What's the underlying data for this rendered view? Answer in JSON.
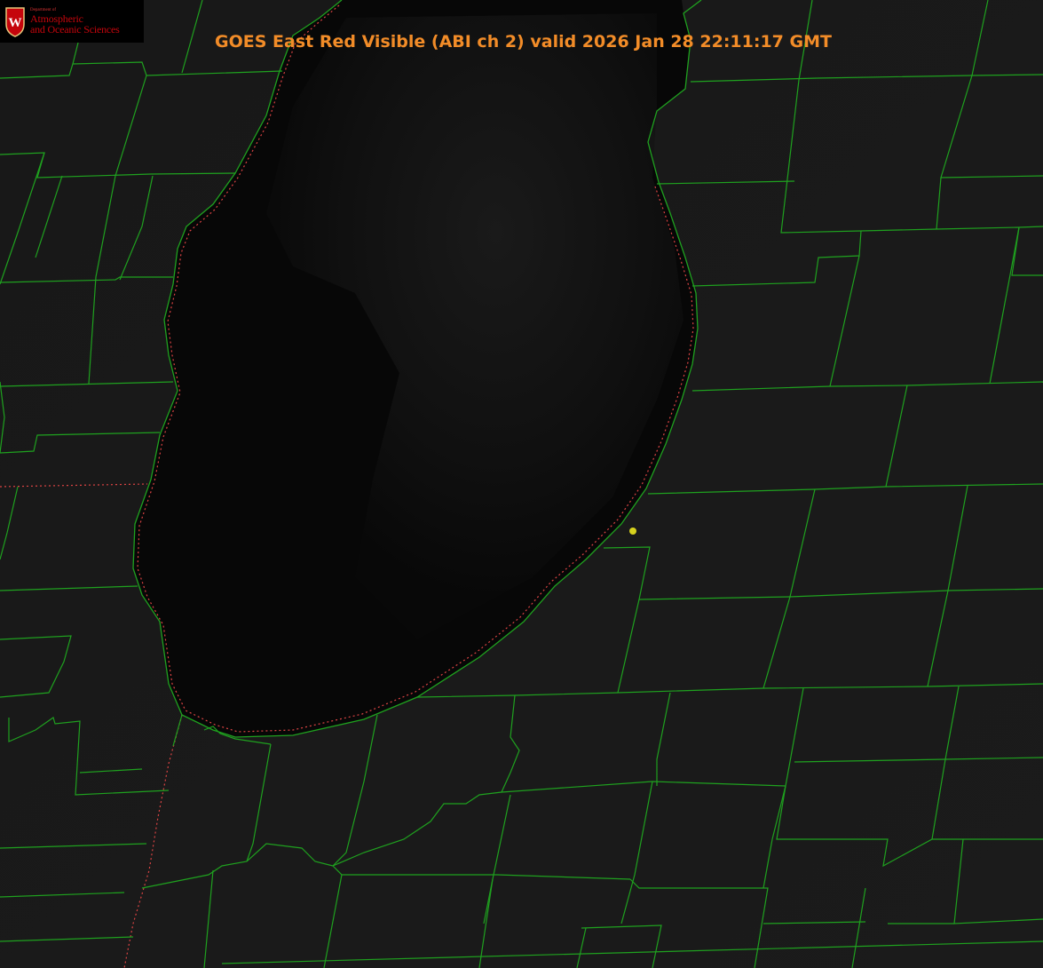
{
  "logo": {
    "department": "Department of",
    "line1": "Atmospheric",
    "line2": "and Oceanic Sciences",
    "crest_letter": "W",
    "crest_icon": "uw-crest-icon"
  },
  "title": "GOES East Red Visible (ABI ch 2) valid 2026 Jan 28 22:11:17 GMT",
  "colors": {
    "title": "#f28c28",
    "county_lines": "#1fa11f",
    "state_line": "#d44",
    "marker": "#d7d21e",
    "land": "#161616",
    "lake": "#050505",
    "logo_text": "#c5050c"
  }
}
